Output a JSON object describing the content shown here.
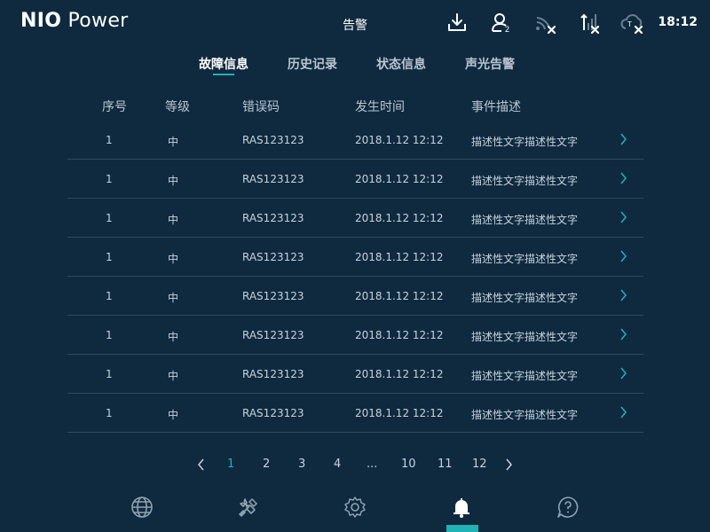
{
  "header": {
    "logo_bold": "NIO",
    "logo_light": " Power",
    "title": "告警",
    "time": "18:12",
    "icons": [
      "download-icon",
      "user-count-icon",
      "wifi-off-icon",
      "signal-off-icon",
      "cloud-off-icon"
    ],
    "user_count_badge": "2"
  },
  "tabs": [
    {
      "label": "故障信息",
      "active": true
    },
    {
      "label": "历史记录",
      "active": false
    },
    {
      "label": "状态信息",
      "active": false
    },
    {
      "label": "声光告警",
      "active": false
    }
  ],
  "table": {
    "columns": [
      "序号",
      "等级",
      "错误码",
      "发生时间",
      "事件描述"
    ],
    "rows": [
      {
        "no": "1",
        "level": "中",
        "code": "RAS123123",
        "time": "2018.1.12 12:12",
        "desc": "描述性文字描述性文字"
      },
      {
        "no": "1",
        "level": "中",
        "code": "RAS123123",
        "time": "2018.1.12 12:12",
        "desc": "描述性文字描述性文字"
      },
      {
        "no": "1",
        "level": "中",
        "code": "RAS123123",
        "time": "2018.1.12 12:12",
        "desc": "描述性文字描述性文字"
      },
      {
        "no": "1",
        "level": "中",
        "code": "RAS123123",
        "time": "2018.1.12 12:12",
        "desc": "描述性文字描述性文字"
      },
      {
        "no": "1",
        "level": "中",
        "code": "RAS123123",
        "time": "2018.1.12 12:12",
        "desc": "描述性文字描述性文字"
      },
      {
        "no": "1",
        "level": "中",
        "code": "RAS123123",
        "time": "2018.1.12 12:12",
        "desc": "描述性文字描述性文字"
      },
      {
        "no": "1",
        "level": "中",
        "code": "RAS123123",
        "time": "2018.1.12 12:12",
        "desc": "描述性文字描述性文字"
      },
      {
        "no": "1",
        "level": "中",
        "code": "RAS123123",
        "time": "2018.1.12 12:12",
        "desc": "描述性文字描述性文字"
      }
    ]
  },
  "pagination": {
    "pages": [
      "1",
      "2",
      "3",
      "4",
      "...",
      "10",
      "11",
      "12"
    ],
    "current": "1"
  },
  "bottom_nav": {
    "items": [
      "globe-icon",
      "tools-icon",
      "settings-icon",
      "alarm-bell-icon",
      "help-icon"
    ],
    "active": "alarm-bell-icon"
  },
  "colors": {
    "background": "#0f2a3f",
    "accent": "#1fb3b5",
    "divider": "#2d4a5e"
  }
}
